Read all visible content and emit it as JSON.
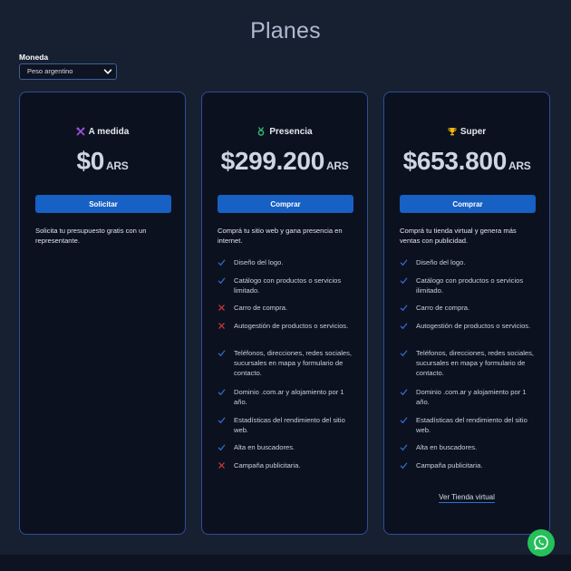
{
  "page": {
    "title": "Planes"
  },
  "currency": {
    "label": "Moneda",
    "selected": "Peso argentino"
  },
  "plans": [
    {
      "name": "A medida",
      "icon": "tools-icon",
      "price": "$0",
      "currency": "ARS",
      "button": "Solicitar",
      "description": "Solicita tu presupuesto gratis con un representante.",
      "features": []
    },
    {
      "name": "Presencia",
      "icon": "medal-icon",
      "price": "$299.200",
      "currency": "ARS",
      "button": "Comprar",
      "description": "Comprá tu sitio web y gana presencia en internet.",
      "features": [
        {
          "text": "Diseño del logo.",
          "included": true
        },
        {
          "text": "Catálogo con productos o servicios limitado.",
          "included": true
        },
        {
          "text": "Carro de compra.",
          "included": false
        },
        {
          "text": "Autogestión de productos o servicios.",
          "included": false
        },
        {
          "text": "Teléfonos, direcciones, redes sociales, sucursales en mapa y formulario de contacto.",
          "included": true
        },
        {
          "text": "Dominio .com.ar y alojamiento por 1 año.",
          "included": true
        },
        {
          "text": "Estadísticas del rendimiento del sitio web.",
          "included": true
        },
        {
          "text": "Alta en buscadores.",
          "included": true
        },
        {
          "text": "Campaña publicitaria.",
          "included": false
        }
      ]
    },
    {
      "name": "Super",
      "icon": "trophy-icon",
      "price": "$653.800",
      "currency": "ARS",
      "button": "Comprar",
      "description": "Comprá tu tienda virtual y genera más ventas con publicidad.",
      "features": [
        {
          "text": "Diseño del logo.",
          "included": true
        },
        {
          "text": "Catálogo con productos o servicios ilimitado.",
          "included": true
        },
        {
          "text": "Carro de compra.",
          "included": true
        },
        {
          "text": "Autogestión de productos o servicios.",
          "included": true
        },
        {
          "text": "Teléfonos, direcciones, redes sociales, sucursales en mapa y formulario de contacto.",
          "included": true
        },
        {
          "text": "Dominio .com.ar y alojamiento por 1 año.",
          "included": true
        },
        {
          "text": "Estadísticas del rendimiento del sitio web.",
          "included": true
        },
        {
          "text": "Alta en buscadores.",
          "included": true
        },
        {
          "text": "Campaña publicitaria.",
          "included": true
        }
      ],
      "link": "Ver Tienda virtual"
    }
  ],
  "colors": {
    "accent": "#1760c4",
    "check": "#2f6fd0",
    "cross": "#d83a3a",
    "tools": "#9b4fd6",
    "medal": "#2fbf71",
    "trophy": "#f2b705",
    "whatsapp": "#25c05a"
  },
  "whatsapp": {
    "icon": "whatsapp-icon"
  }
}
